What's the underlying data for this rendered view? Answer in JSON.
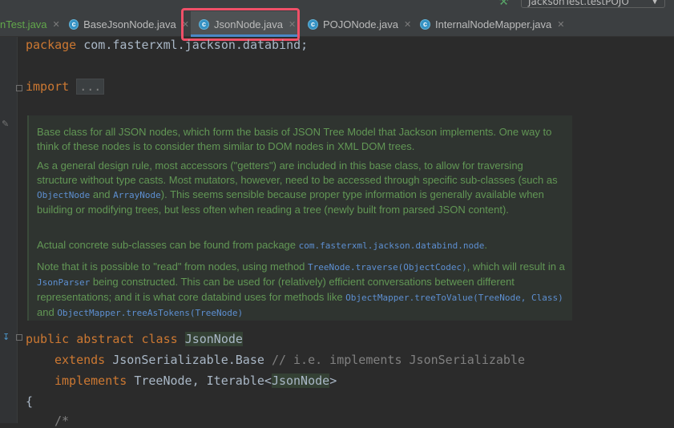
{
  "toolbar": {
    "run_config": "JacksonTest.testPOJO"
  },
  "tabs": [
    {
      "label": "nTest.java"
    },
    {
      "label": "BaseJsonNode.java"
    },
    {
      "label": "JsonNode.java"
    },
    {
      "label": "POJONode.java"
    },
    {
      "label": "InternalNodeMapper.java"
    }
  ],
  "code": {
    "package_kw": "package",
    "package_name": "com.fasterxml.jackson.databind;",
    "import_kw": "import",
    "import_folded": "...",
    "class_line": {
      "kw1": "public",
      "kw2": "abstract",
      "kw3": "class",
      "name": "JsonNode"
    },
    "extends_line": {
      "kw": "extends",
      "type": "JsonSerializable.Base",
      "comment": "// i.e. implements JsonSerializable"
    },
    "implements_line": {
      "kw": "implements",
      "t1": "TreeNode,",
      "t2": "Iterable<",
      "t3": "JsonNode",
      "t4": ">"
    },
    "brace": "{",
    "comment_start": "/*"
  },
  "javadoc": {
    "p1": "Base class for all JSON nodes, which form the basis of JSON Tree Model that Jackson implements. One way to think of these nodes is to consider them similar to DOM nodes in XML DOM trees.",
    "p2a": "As a general design rule, most accessors (\"getters\") are included in this base class, to allow for traversing structure without type casts. Most mutators, however, need to be accessed through specific sub-classes (such as ",
    "p2_code1": "ObjectNode",
    "p2b": " and ",
    "p2_code2": "ArrayNode",
    "p2c": "). This seems sensible because proper type information is generally available when building or modifying trees, but less often when reading a tree (newly built from parsed JSON content).",
    "p3a": "Actual concrete sub-classes can be found from package ",
    "p3_code": "com.fasterxml.jackson.databind.node",
    "p3b": ".",
    "p4a": "Note that it is possible to \"read\" from nodes, using method ",
    "p4_code1": "TreeNode.traverse(ObjectCodec)",
    "p4b": ", which will result in a ",
    "p4_code2": "JsonParser",
    "p4c": " being constructed. This can be used for (relatively) efficient conversations between different representations; and it is what core databind uses for methods like ",
    "p4_code3": "ObjectMapper.treeToValue(TreeNode, Class)",
    "p4d": " and ",
    "p4_code4": "ObjectMapper.treeAsTokens(TreeNode)"
  }
}
